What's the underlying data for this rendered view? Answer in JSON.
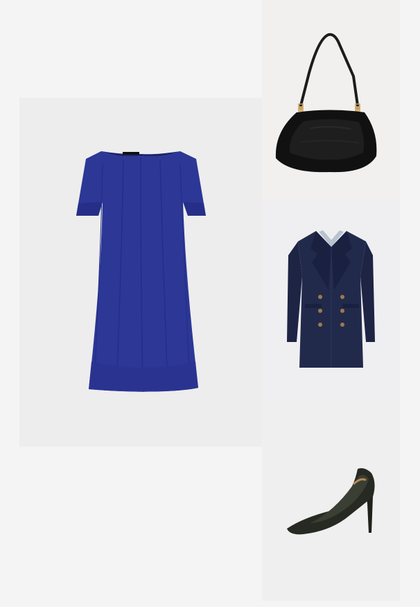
{
  "colors": {
    "background": "#f4f4f4",
    "dress": "#2c3796",
    "blazer": "#1f2748",
    "bag": "#111111",
    "pumps": "#262a22"
  },
  "products": [
    {
      "name": "dress",
      "icon": "blue-short-sleeve-dress"
    },
    {
      "name": "bag",
      "icon": "black-shoulder-bag"
    },
    {
      "name": "blazer",
      "icon": "navy-double-breasted-blazer-dress"
    },
    {
      "name": "pumps",
      "icon": "dark-green-pointed-pumps"
    }
  ]
}
